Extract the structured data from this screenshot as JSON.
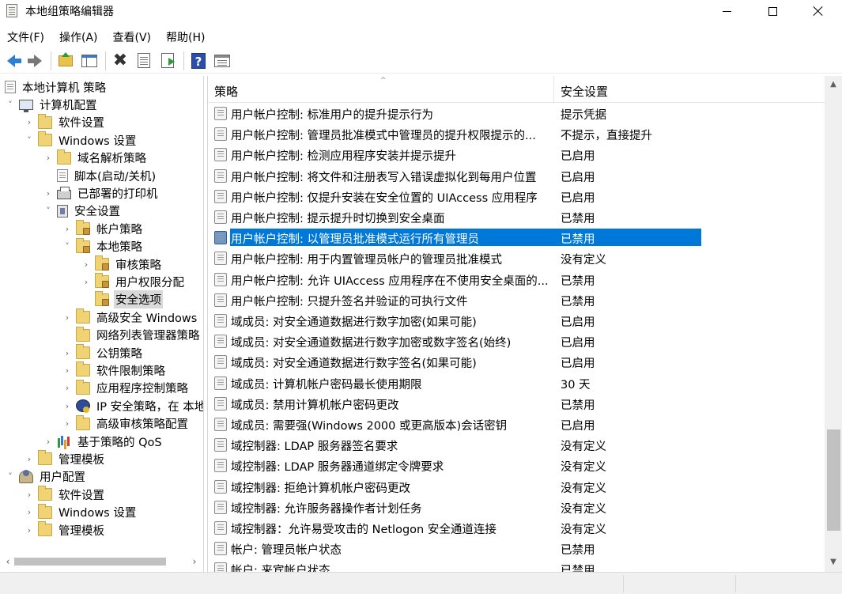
{
  "window": {
    "title": "本地组策略编辑器"
  },
  "menu": [
    "文件(F)",
    "操作(A)",
    "查看(V)",
    "帮助(H)"
  ],
  "toolbar": {
    "icons": [
      "back-arrow-icon",
      "forward-arrow-icon",
      "up-folder-icon",
      "show-hide-pane-icon",
      "delete-icon",
      "properties-icon",
      "export-list-icon",
      "help-icon",
      "view-icon"
    ]
  },
  "tree": [
    {
      "label": "本地计算机 策略",
      "depth": 0,
      "chev": "",
      "icon": "doc",
      "selected": false
    },
    {
      "label": "计算机配置",
      "depth": 1,
      "chev": "v",
      "icon": "computer",
      "selected": false
    },
    {
      "label": "软件设置",
      "depth": 2,
      "chev": ">",
      "icon": "folder",
      "selected": false
    },
    {
      "label": "Windows 设置",
      "depth": 2,
      "chev": "v",
      "icon": "folder",
      "selected": false
    },
    {
      "label": "域名解析策略",
      "depth": 3,
      "chev": ">",
      "icon": "folder",
      "selected": false
    },
    {
      "label": "脚本(启动/关机)",
      "depth": 3,
      "chev": "",
      "icon": "doc",
      "selected": false
    },
    {
      "label": "已部署的打印机",
      "depth": 3,
      "chev": ">",
      "icon": "printer",
      "selected": false
    },
    {
      "label": "安全设置",
      "depth": 3,
      "chev": "v",
      "icon": "shieldpc",
      "selected": false
    },
    {
      "label": "帐户策略",
      "depth": 4,
      "chev": ">",
      "icon": "folder-lock",
      "selected": false
    },
    {
      "label": "本地策略",
      "depth": 4,
      "chev": "v",
      "icon": "folder-lock",
      "selected": false
    },
    {
      "label": "审核策略",
      "depth": 5,
      "chev": ">",
      "icon": "folder-lock",
      "selected": false
    },
    {
      "label": "用户权限分配",
      "depth": 5,
      "chev": ">",
      "icon": "folder-lock",
      "selected": false
    },
    {
      "label": "安全选项",
      "depth": 5,
      "chev": "",
      "icon": "folder-lock",
      "selected": true
    },
    {
      "label": "高级安全 Windows",
      "depth": 4,
      "chev": ">",
      "icon": "folder",
      "selected": false
    },
    {
      "label": "网络列表管理器策略",
      "depth": 4,
      "chev": "",
      "icon": "folder",
      "selected": false
    },
    {
      "label": "公钥策略",
      "depth": 4,
      "chev": ">",
      "icon": "folder",
      "selected": false
    },
    {
      "label": "软件限制策略",
      "depth": 4,
      "chev": ">",
      "icon": "folder",
      "selected": false
    },
    {
      "label": "应用程序控制策略",
      "depth": 4,
      "chev": ">",
      "icon": "folder",
      "selected": false
    },
    {
      "label": "IP 安全策略，在 本地",
      "depth": 4,
      "chev": ">",
      "icon": "ipsec",
      "selected": false
    },
    {
      "label": "高级审核策略配置",
      "depth": 4,
      "chev": ">",
      "icon": "folder",
      "selected": false
    },
    {
      "label": "基于策略的 QoS",
      "depth": 3,
      "chev": ">",
      "icon": "qos",
      "selected": false
    },
    {
      "label": "管理模板",
      "depth": 2,
      "chev": ">",
      "icon": "folder",
      "selected": false
    },
    {
      "label": "用户配置",
      "depth": 1,
      "chev": "v",
      "icon": "users",
      "selected": false
    },
    {
      "label": "软件设置",
      "depth": 2,
      "chev": ">",
      "icon": "folder",
      "selected": false
    },
    {
      "label": "Windows 设置",
      "depth": 2,
      "chev": ">",
      "icon": "folder",
      "selected": false
    },
    {
      "label": "管理模板",
      "depth": 2,
      "chev": ">",
      "icon": "folder",
      "selected": false
    }
  ],
  "list": {
    "headers": {
      "policy": "策略",
      "setting": "安全设置"
    },
    "rows": [
      {
        "name": "用户帐户控制: 标准用户的提升提示行为",
        "value": "提示凭据",
        "selected": false
      },
      {
        "name": "用户帐户控制: 管理员批准模式中管理员的提升权限提示的...",
        "value": "不提示，直接提升",
        "selected": false
      },
      {
        "name": "用户帐户控制: 检测应用程序安装并提示提升",
        "value": "已启用",
        "selected": false
      },
      {
        "name": "用户帐户控制: 将文件和注册表写入错误虚拟化到每用户位置",
        "value": "已启用",
        "selected": false
      },
      {
        "name": "用户帐户控制: 仅提升安装在安全位置的 UIAccess 应用程序",
        "value": "已启用",
        "selected": false
      },
      {
        "name": "用户帐户控制: 提示提升时切换到安全桌面",
        "value": "已禁用",
        "selected": false
      },
      {
        "name": "用户帐户控制: 以管理员批准模式运行所有管理员",
        "value": "已禁用",
        "selected": true
      },
      {
        "name": "用户帐户控制: 用于内置管理员帐户的管理员批准模式",
        "value": "没有定义",
        "selected": false
      },
      {
        "name": "用户帐户控制: 允许 UIAccess 应用程序在不使用安全桌面的...",
        "value": "已禁用",
        "selected": false
      },
      {
        "name": "用户帐户控制: 只提升签名并验证的可执行文件",
        "value": "已禁用",
        "selected": false
      },
      {
        "name": "域成员: 对安全通道数据进行数字加密(如果可能)",
        "value": "已启用",
        "selected": false
      },
      {
        "name": "域成员: 对安全通道数据进行数字加密或数字签名(始终)",
        "value": "已启用",
        "selected": false
      },
      {
        "name": "域成员: 对安全通道数据进行数字签名(如果可能)",
        "value": "已启用",
        "selected": false
      },
      {
        "name": "域成员: 计算机帐户密码最长使用期限",
        "value": "30 天",
        "selected": false
      },
      {
        "name": "域成员: 禁用计算机帐户密码更改",
        "value": "已禁用",
        "selected": false
      },
      {
        "name": "域成员: 需要强(Windows 2000 或更高版本)会话密钥",
        "value": "已启用",
        "selected": false
      },
      {
        "name": "域控制器: LDAP 服务器签名要求",
        "value": "没有定义",
        "selected": false
      },
      {
        "name": "域控制器: LDAP 服务器通道绑定令牌要求",
        "value": "没有定义",
        "selected": false
      },
      {
        "name": "域控制器: 拒绝计算机帐户密码更改",
        "value": "没有定义",
        "selected": false
      },
      {
        "name": "域控制器: 允许服务器操作者计划任务",
        "value": "没有定义",
        "selected": false
      },
      {
        "name": "域控制器：允许易受攻击的 Netlogon 安全通道连接",
        "value": "没有定义",
        "selected": false
      },
      {
        "name": "帐户: 管理员帐户状态",
        "value": "已禁用",
        "selected": false
      },
      {
        "name": "帐户: 来宾帐户状态",
        "value": "已禁用",
        "selected": false
      }
    ]
  },
  "colors": {
    "selection": "#0078d7",
    "tree_selection": "#d9d9d9"
  }
}
